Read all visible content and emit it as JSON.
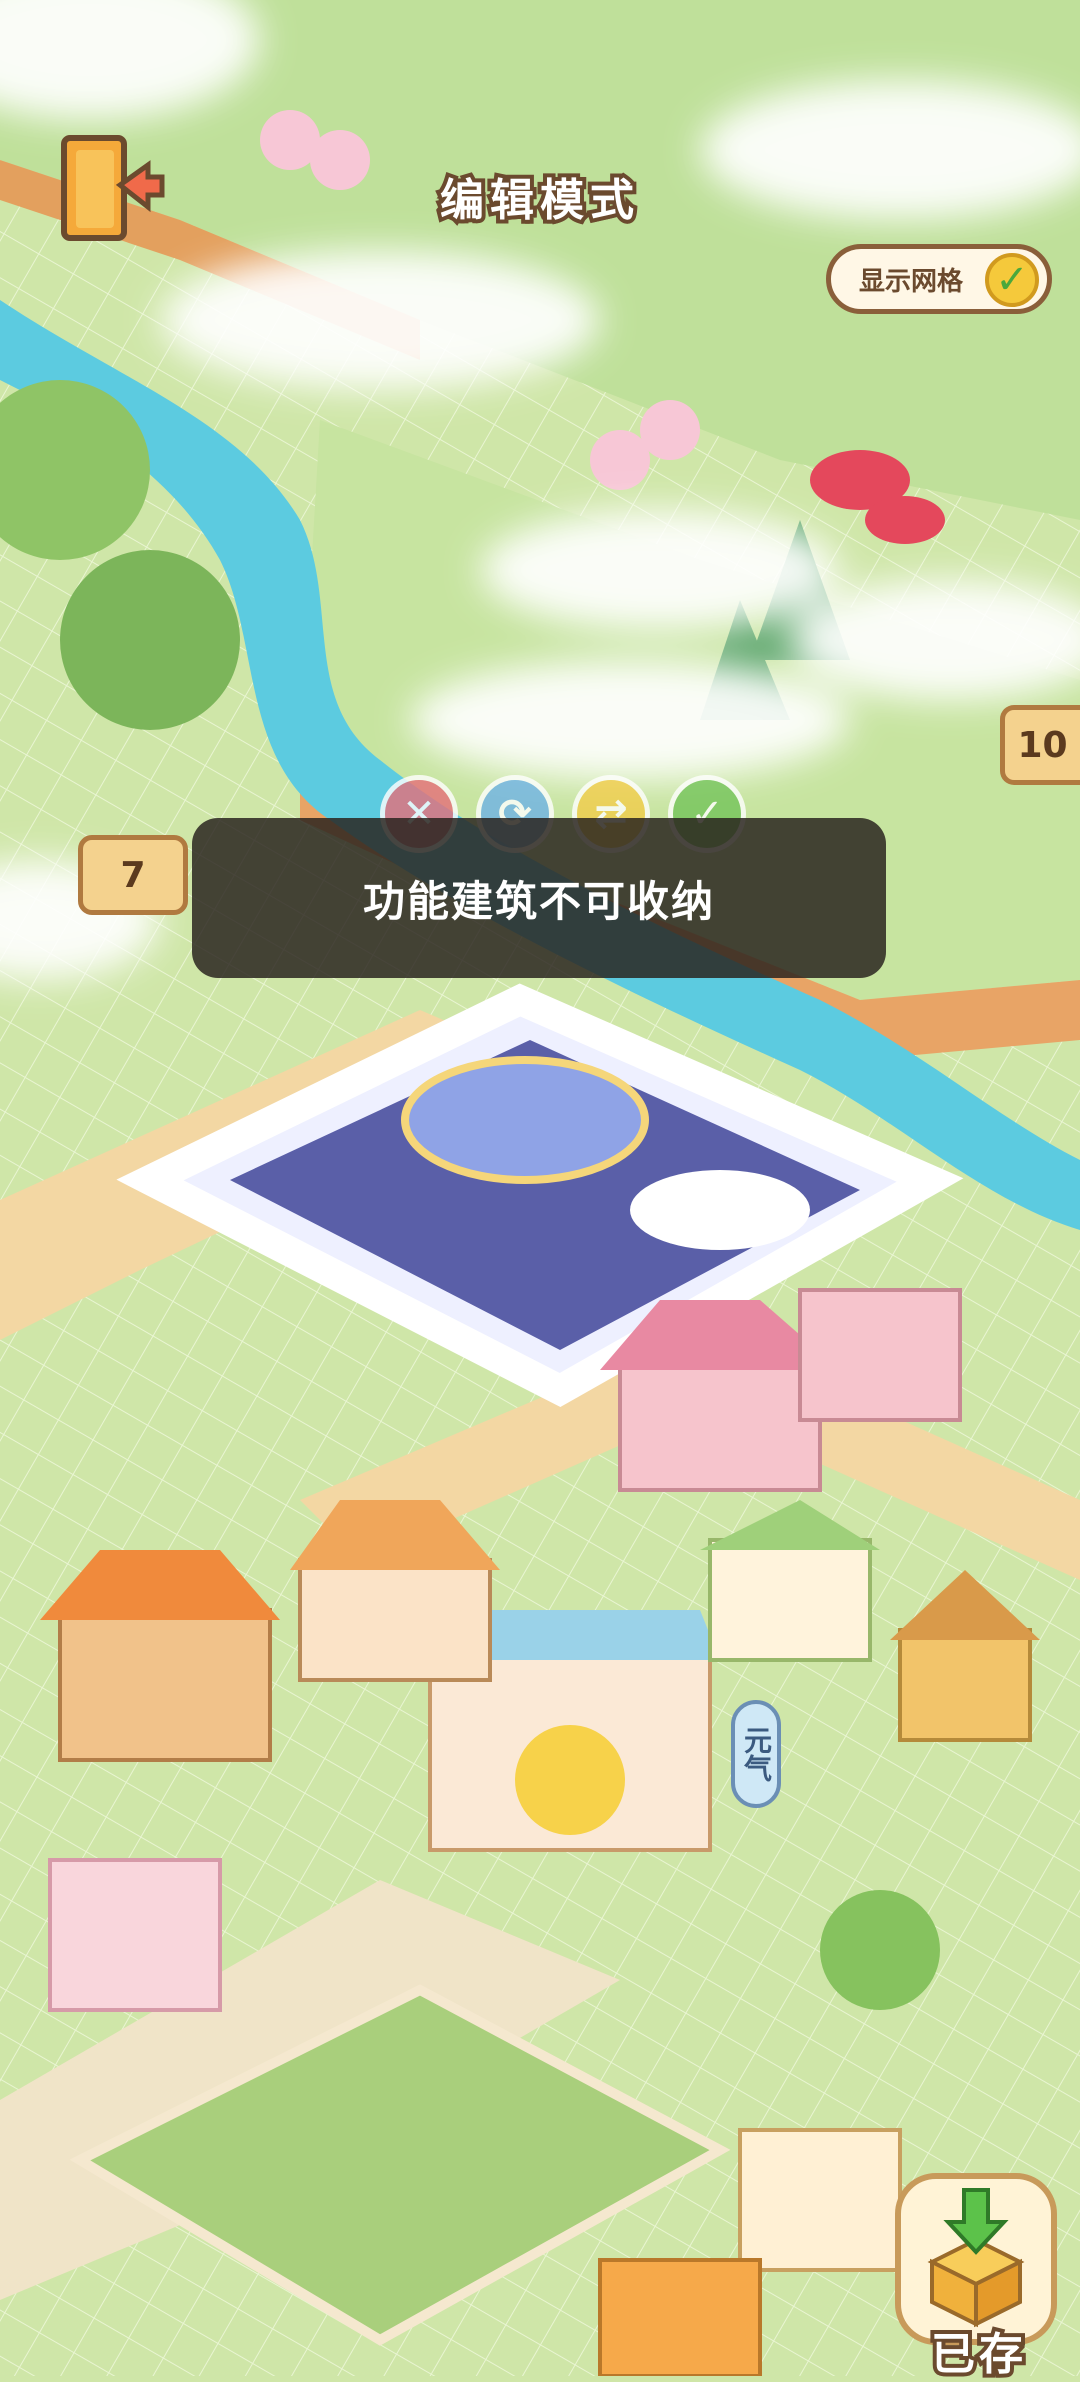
{
  "header": {
    "title": "编辑模式",
    "grid_toggle_label": "显示网格"
  },
  "signs": {
    "left_number": "7",
    "right_number": "10"
  },
  "actions": {
    "cancel_icon": "x-icon",
    "rotate_icon": "rotate-icon",
    "flip_icon": "flip-icon",
    "confirm_icon": "check-icon"
  },
  "toast": {
    "message": "功能建筑不可收纳"
  },
  "store_sign": "元气",
  "storage": {
    "label": "已存"
  },
  "colors": {
    "grass": "#cfe6a8",
    "path": "#f3d7a3",
    "river": "#5ccbe0",
    "toast_bg": "#28221e",
    "accent_brown": "#6b4a2e"
  }
}
